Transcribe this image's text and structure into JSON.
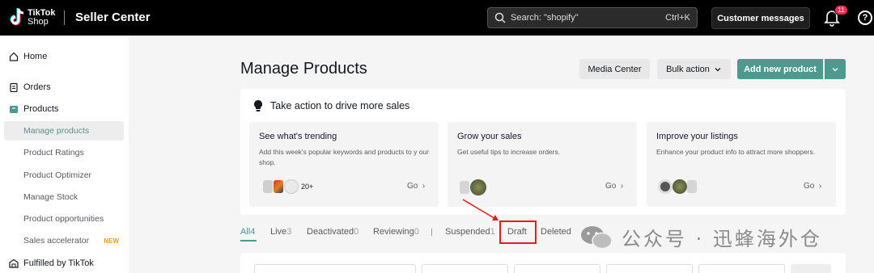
{
  "header": {
    "logo_line1": "TikTok",
    "logo_line2": "Shop",
    "app_title": "Seller Center",
    "search_placeholder": "Search: \"shopify\"",
    "search_shortcut": "Ctrl+K",
    "customer_messages": "Customer messages",
    "notification_count": "11",
    "help_glyph": "?"
  },
  "sidebar": {
    "items": [
      {
        "label": "Home",
        "icon": "home-icon"
      },
      {
        "label": "Orders",
        "icon": "clipboard-icon"
      },
      {
        "label": "Products",
        "icon": "product-box-icon"
      }
    ],
    "product_subitems": [
      {
        "label": "Manage products",
        "active": true
      },
      {
        "label": "Product Ratings"
      },
      {
        "label": "Product Optimizer"
      },
      {
        "label": "Manage Stock"
      },
      {
        "label": "Product opportunities"
      },
      {
        "label": "Sales accelerator",
        "tag": "NEW"
      }
    ],
    "fulfilled": {
      "label": "Fulfilled by TikTok",
      "icon": "warehouse-icon"
    }
  },
  "main": {
    "title": "Manage Products",
    "buttons": {
      "media_center": "Media Center",
      "bulk_action": "Bulk action",
      "add_new_product": "Add new product"
    },
    "action_card": {
      "title": "Take action to drive more sales",
      "cards": [
        {
          "title": "See what's trending",
          "desc": "Add this week's popular keywords and products to y our shop.",
          "extra": "20+",
          "go": "Go"
        },
        {
          "title": "Grow your sales",
          "desc": "Get useful tips to increase orders.",
          "go": "Go"
        },
        {
          "title": "Improve your listings",
          "desc": "Enhance your product info to attract more shoppers.",
          "go": "Go"
        }
      ]
    },
    "tabs": [
      {
        "label": "All",
        "count": "4",
        "active": true
      },
      {
        "label": "Live",
        "count": "3"
      },
      {
        "label": "Deactivated",
        "count": "0"
      },
      {
        "label": "Reviewing",
        "count": "0"
      },
      {
        "label": "Suspended",
        "count": "1"
      },
      {
        "label": "Draft",
        "count": ""
      },
      {
        "label": "Deleted",
        "count": ""
      }
    ]
  },
  "watermark": {
    "text": "公众号 · 迅蜂海外仓"
  },
  "colors": {
    "accent": "#4b9a8d",
    "badge": "#fe2c55",
    "highlight": "#e11d1d",
    "new_tag": "#e2a400"
  }
}
